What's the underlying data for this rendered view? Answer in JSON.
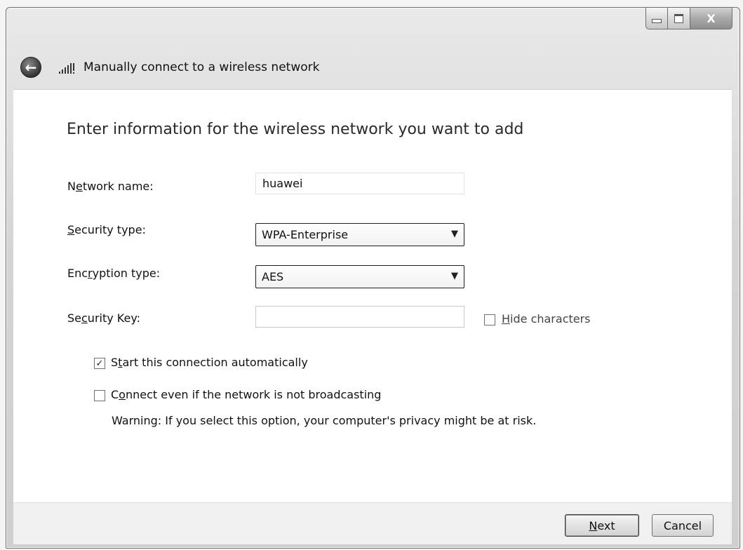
{
  "window": {
    "title": "Manually connect to a wireless network",
    "controls": {
      "minimize": "minimize",
      "maximize": "maximize",
      "close": "X"
    }
  },
  "heading": "Enter information for the wireless network you want to add",
  "fields": {
    "network_name": {
      "label_pre": "N",
      "label_key": "e",
      "label_post": "twork name:",
      "value": "huawei"
    },
    "security_type": {
      "label_pre": "",
      "label_key": "S",
      "label_post": "ecurity type:",
      "value": "WPA-Enterprise"
    },
    "encryption_type": {
      "label_pre": "Enc",
      "label_key": "r",
      "label_post": "yption type:",
      "value": "AES"
    },
    "security_key": {
      "label_pre": "Se",
      "label_key": "c",
      "label_post": "urity Key:",
      "value": ""
    }
  },
  "hide_characters": {
    "label_pre": "",
    "label_key": "H",
    "label_post": "ide characters",
    "checked": false
  },
  "start_automatically": {
    "label_pre": "S",
    "label_key": "t",
    "label_post": "art this connection automatically",
    "checked": true
  },
  "connect_not_broadcasting": {
    "label_pre": "C",
    "label_key": "o",
    "label_post": "nnect even if the network is not broadcasting",
    "checked": false
  },
  "warning": "Warning: If you select this option, your computer's privacy might be at risk.",
  "buttons": {
    "next": {
      "label_pre": "",
      "label_key": "N",
      "label_post": "ext"
    },
    "cancel": "Cancel"
  },
  "icons": {
    "back": "back-arrow-icon",
    "signal": "wireless-signal-icon",
    "check": "checkmark-icon",
    "dropdown": "chevron-down-icon"
  }
}
